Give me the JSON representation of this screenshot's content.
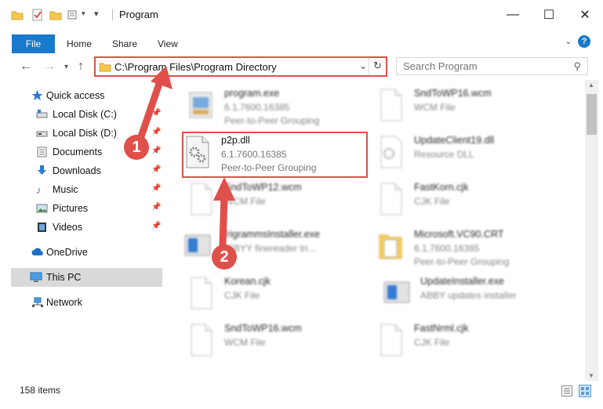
{
  "window": {
    "title": "Program"
  },
  "ribbon": {
    "tabs": [
      "File",
      "Home",
      "Share",
      "View"
    ]
  },
  "address": {
    "path": "C:\\Program Files\\Program Directory"
  },
  "search": {
    "placeholder": "Search Program"
  },
  "sidebar": {
    "items": [
      {
        "label": "Quick access",
        "icon": "star-icon"
      },
      {
        "label": "Local Disk (C:)",
        "icon": "drive-icon",
        "pinned": true
      },
      {
        "label": "Local Disk (D:)",
        "icon": "drive-icon",
        "pinned": true
      },
      {
        "label": "Documents",
        "icon": "documents-icon",
        "pinned": true
      },
      {
        "label": "Downloads",
        "icon": "download-icon",
        "pinned": true
      },
      {
        "label": "Music",
        "icon": "music-icon",
        "pinned": true
      },
      {
        "label": "Pictures",
        "icon": "pictures-icon",
        "pinned": true
      },
      {
        "label": "Videos",
        "icon": "videos-icon",
        "pinned": true
      },
      {
        "label": "OneDrive",
        "icon": "cloud-icon"
      },
      {
        "label": "This PC",
        "icon": "pc-icon",
        "selected": true
      },
      {
        "label": "Network",
        "icon": "network-icon"
      }
    ]
  },
  "files": [
    {
      "name": "program.exe",
      "line2": "6.1.7600.16385",
      "line3": "Peer-to-Peer Grouping",
      "icon": "exe-icon"
    },
    {
      "name": "SndToWP16.wcm",
      "line2": "WCM File",
      "line3": "",
      "icon": "file-icon"
    },
    {
      "name": "p2p.dll",
      "line2": "6.1.7600.16385",
      "line3": "Peer-to-Peer Grouping",
      "icon": "dll-gear-icon"
    },
    {
      "name": "UpdateClient19.dll",
      "line2": "Resource DLL",
      "line3": "",
      "icon": "dll-gear-icon"
    },
    {
      "name": "SndToWP12.wcm",
      "line2": "WCM File",
      "line3": "",
      "icon": "file-icon"
    },
    {
      "name": "FastKorn.cjk",
      "line2": "CJK File",
      "line3": "",
      "icon": "file-icon"
    },
    {
      "name": "TrigrammsInstaller.exe",
      "line2": "ABBYY finereader tri...",
      "line3": "",
      "icon": "installer-icon"
    },
    {
      "name": "Microsoft.VC90.CRT",
      "line2": "6.1.7600.16385",
      "line3": "Peer-to-Peer Grouping",
      "icon": "folder-doc-icon"
    },
    {
      "name": "Korean.cjk",
      "line2": "CJK File",
      "line3": "",
      "icon": "file-icon"
    },
    {
      "name": "UpdateInstaller.exe",
      "line2": "ABBY updates installer",
      "line3": "",
      "icon": "installer-icon"
    },
    {
      "name": "SndToWP16.wcm",
      "line2": "WCM File",
      "line3": "",
      "icon": "file-icon"
    },
    {
      "name": "FastNrml.cjk",
      "line2": "CJK File",
      "line3": "",
      "icon": "file-icon"
    }
  ],
  "status": {
    "count": "158 items"
  },
  "annotations": {
    "step1": "1",
    "step2": "2"
  },
  "colors": {
    "accent": "#1979ca",
    "highlight": "#e0504a"
  }
}
